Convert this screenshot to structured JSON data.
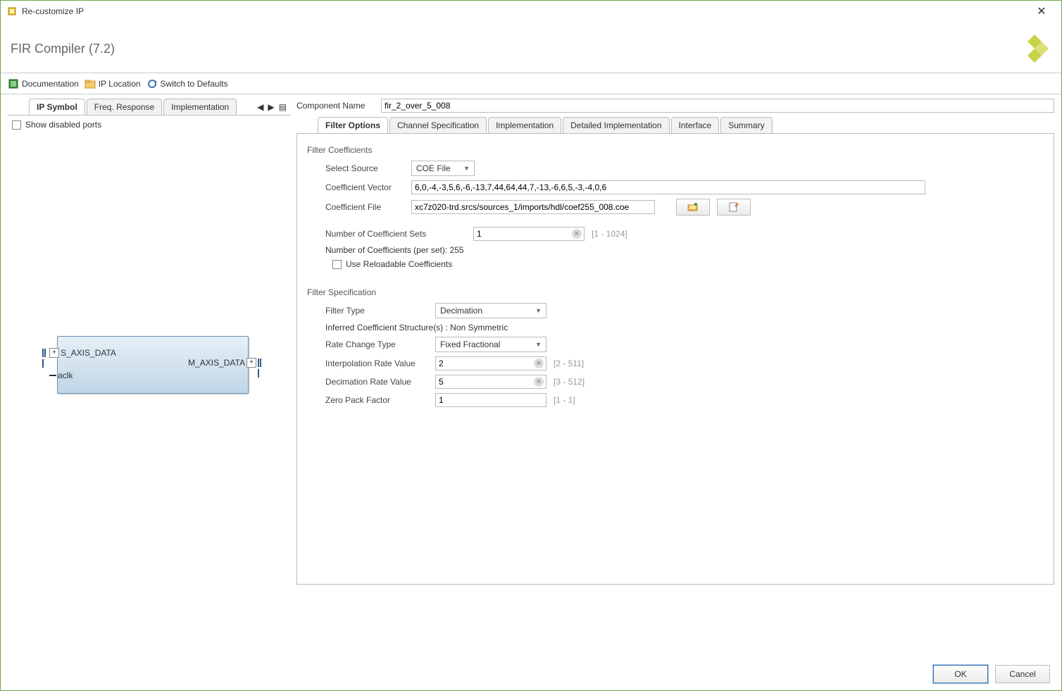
{
  "window": {
    "title": "Re-customize IP"
  },
  "header": {
    "title": "FIR Compiler (7.2)"
  },
  "toolbar": {
    "doc": "Documentation",
    "iploc": "IP Location",
    "defaults": "Switch to Defaults"
  },
  "left": {
    "tabs": [
      "IP Symbol",
      "Freq. Response",
      "Implementation"
    ],
    "show_disabled": "Show disabled ports",
    "ports": {
      "s_axis": "S_AXIS_DATA",
      "aclk": "aclk",
      "m_axis": "M_AXIS_DATA"
    }
  },
  "right": {
    "component_label": "Component Name",
    "component_name": "fir_2_over_5_008",
    "tabs": [
      "Filter Options",
      "Channel Specification",
      "Implementation",
      "Detailed Implementation",
      "Interface",
      "Summary"
    ],
    "filter_coeff_title": "Filter Coefficients",
    "select_source_label": "Select Source",
    "select_source_value": "COE File",
    "coeff_vector_label": "Coefficient Vector",
    "coeff_vector_value": "6,0,-4,-3,5,6,-6,-13,7,44,64,44,7,-13,-6,6,5,-3,-4,0,6",
    "coeff_file_label": "Coefficient File",
    "coeff_file_value": "xc7z020-trd.srcs/sources_1/imports/hdl/coef255_008.coe",
    "num_sets_label": "Number of Coefficient Sets",
    "num_sets_value": "1",
    "num_sets_hint": "[1 - 1024]",
    "num_per_set": "Number of Coefficients (per set): 255",
    "reloadable": "Use Reloadable Coefficients",
    "filter_spec_title": "Filter Specification",
    "filter_type_label": "Filter Type",
    "filter_type_value": "Decimation",
    "inferred": "Inferred Coefficient Structure(s) : Non Symmetric",
    "rate_change_label": "Rate Change Type",
    "rate_change_value": "Fixed Fractional",
    "interp_label": "Interpolation Rate Value",
    "interp_value": "2",
    "interp_hint": "[2 - 511]",
    "decim_label": "Decimation Rate Value",
    "decim_value": "5",
    "decim_hint": "[3 - 512]",
    "zero_label": "Zero Pack Factor",
    "zero_value": "1",
    "zero_hint": "[1 - 1]"
  },
  "footer": {
    "ok": "OK",
    "cancel": "Cancel"
  }
}
